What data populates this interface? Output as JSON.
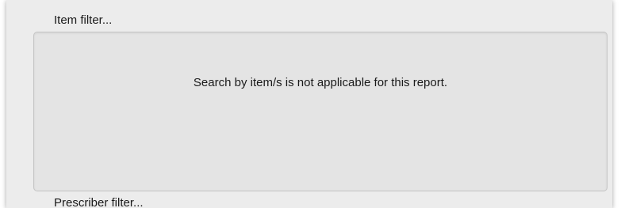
{
  "item_filter": {
    "title": "Item filter...",
    "message": "Search by item/s is not applicable for this report."
  },
  "prescriber_filter": {
    "title": "Prescriber filter..."
  }
}
